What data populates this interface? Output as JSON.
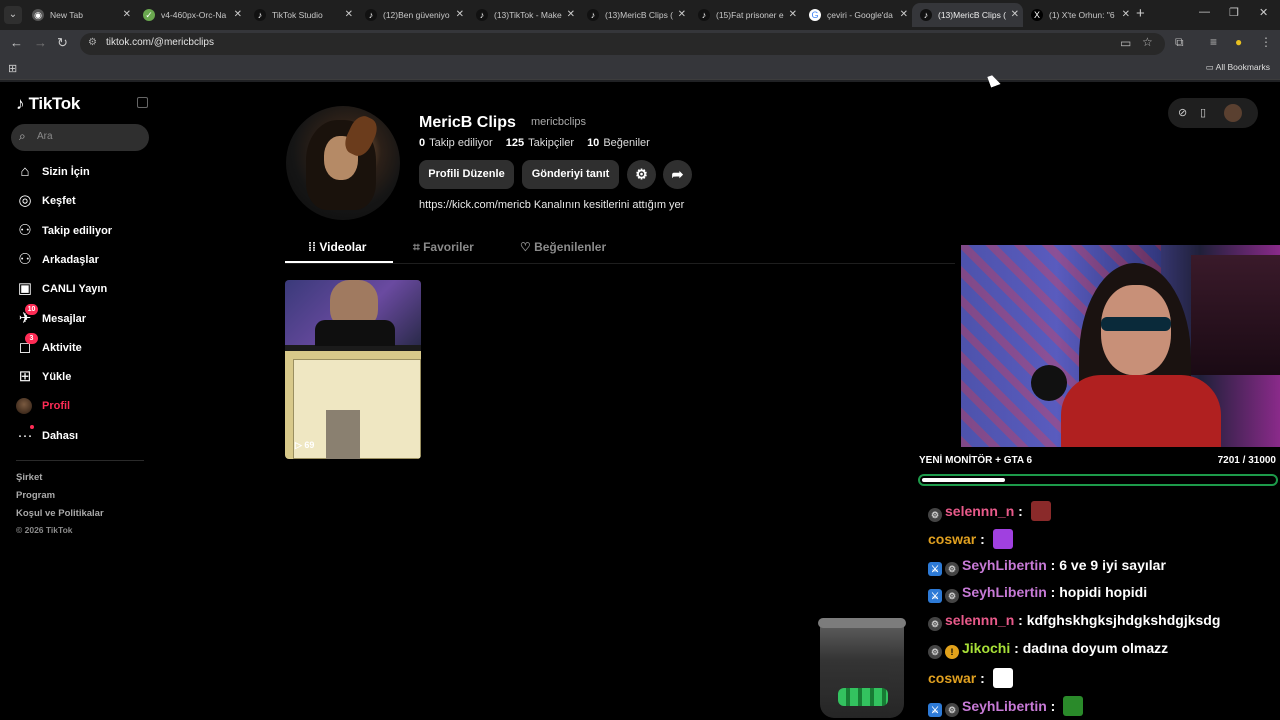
{
  "browser": {
    "tabs": [
      {
        "title": "New Tab",
        "icon": "chrome-icon"
      },
      {
        "title": "v4-460px-Orc-Na",
        "icon": "wikihow-icon"
      },
      {
        "title": "TikTok Studio",
        "icon": "tiktok-icon"
      },
      {
        "title": "(12)Ben güveniyo",
        "icon": "tiktok-icon"
      },
      {
        "title": "(13)TikTok - Make",
        "icon": "tiktok-icon"
      },
      {
        "title": "(13)MericB Clips (",
        "icon": "tiktok-icon"
      },
      {
        "title": "(15)Fat prisoner e",
        "icon": "tiktok-icon"
      },
      {
        "title": "çeviri - Google'da",
        "icon": "google-icon"
      },
      {
        "title": "(13)MericB Clips (",
        "icon": "tiktok-icon",
        "active": true
      },
      {
        "title": "(1) X'te Orhun: \"6",
        "icon": "x-icon"
      }
    ],
    "url": "tiktok.com/@mericbclips",
    "bookmarks_label": "All Bookmarks"
  },
  "sidebar": {
    "logo": "TikTok",
    "search_placeholder": "Ara",
    "items": [
      {
        "label": "Sizin İçin",
        "icon": "home-icon",
        "glyph": "⌂"
      },
      {
        "label": "Keşfet",
        "icon": "compass-icon",
        "glyph": "◎"
      },
      {
        "label": "Takip ediliyor",
        "icon": "following-icon",
        "glyph": "⚇"
      },
      {
        "label": "Arkadaşlar",
        "icon": "friends-icon",
        "glyph": "⚇"
      },
      {
        "label": "CANLI Yayın",
        "icon": "live-icon",
        "glyph": "▣"
      },
      {
        "label": "Mesajlar",
        "icon": "messages-icon",
        "glyph": "✈",
        "badge": "10"
      },
      {
        "label": "Aktivite",
        "icon": "activity-icon",
        "glyph": "◻",
        "badge": "3"
      },
      {
        "label": "Yükle",
        "icon": "upload-icon",
        "glyph": "⊞"
      },
      {
        "label": "Profil",
        "icon": "profile-avatar-icon",
        "active": true
      },
      {
        "label": "Dahası",
        "icon": "more-icon",
        "glyph": "···"
      }
    ],
    "footer": [
      "Şirket",
      "Program",
      "Koşul ve Politikalar"
    ],
    "copyright": "© 2026 TikTok"
  },
  "profile": {
    "display_name": "MericB Clips",
    "username": "mericbclips",
    "following_count": "0",
    "following_label": "Takip ediliyor",
    "followers_count": "125",
    "followers_label": "Takipçiler",
    "likes_count": "10",
    "likes_label": "Beğeniler",
    "edit_button": "Profili Düzenle",
    "promote_button": "Gönderiyi tanıt",
    "bio": "https://kick.com/mericb Kanalının kesitlerini attığım yer",
    "tabs": [
      {
        "label": "Videolar",
        "icon": "grid-icon",
        "active": true
      },
      {
        "label": "Favoriler",
        "icon": "bookmark-icon"
      },
      {
        "label": "Beğenilenler",
        "icon": "heart-icon"
      }
    ],
    "videos": [
      {
        "views": "69"
      }
    ]
  },
  "stream_overlay": {
    "goal_title": "YENİ MONİTÖR + GTA 6",
    "goal_count": "7201 / 31000",
    "goal_progress": 0.232,
    "chat": [
      {
        "user": "selennn_n",
        "color": "#e85a8a",
        "badges": [
          "gear"
        ],
        "message": "",
        "emote": "#8a2a2a"
      },
      {
        "user": "coswar",
        "color": "#e0a020",
        "badges": [],
        "message": "",
        "emote": "#a040e0"
      },
      {
        "user": "SeyhLibertin",
        "color": "#c77ad6",
        "badges": [
          "mod",
          "gear"
        ],
        "message": "6 ve 9 iyi sayılar"
      },
      {
        "user": "SeyhLibertin",
        "color": "#c77ad6",
        "badges": [
          "mod",
          "gear"
        ],
        "message": "hopidi hopidi"
      },
      {
        "user": "selennn_n",
        "color": "#e85a8a",
        "badges": [
          "gear"
        ],
        "message": "kdfghskhgksjhdgkshdgjksdg"
      },
      {
        "user": "Jikochi",
        "color": "#a8e038",
        "badges": [
          "gear",
          "warn"
        ],
        "message": "dadına doyum olmazz"
      },
      {
        "user": "coswar",
        "color": "#e0a020",
        "badges": [],
        "message": "",
        "emote": "#ffffff"
      },
      {
        "user": "SeyhLibertin",
        "color": "#c77ad6",
        "badges": [
          "mod",
          "gear"
        ],
        "message": "",
        "emote": "#2a8a2a"
      }
    ]
  },
  "colors": {
    "accent": "#fe2c55",
    "goal_border": "#1d9a4a"
  }
}
